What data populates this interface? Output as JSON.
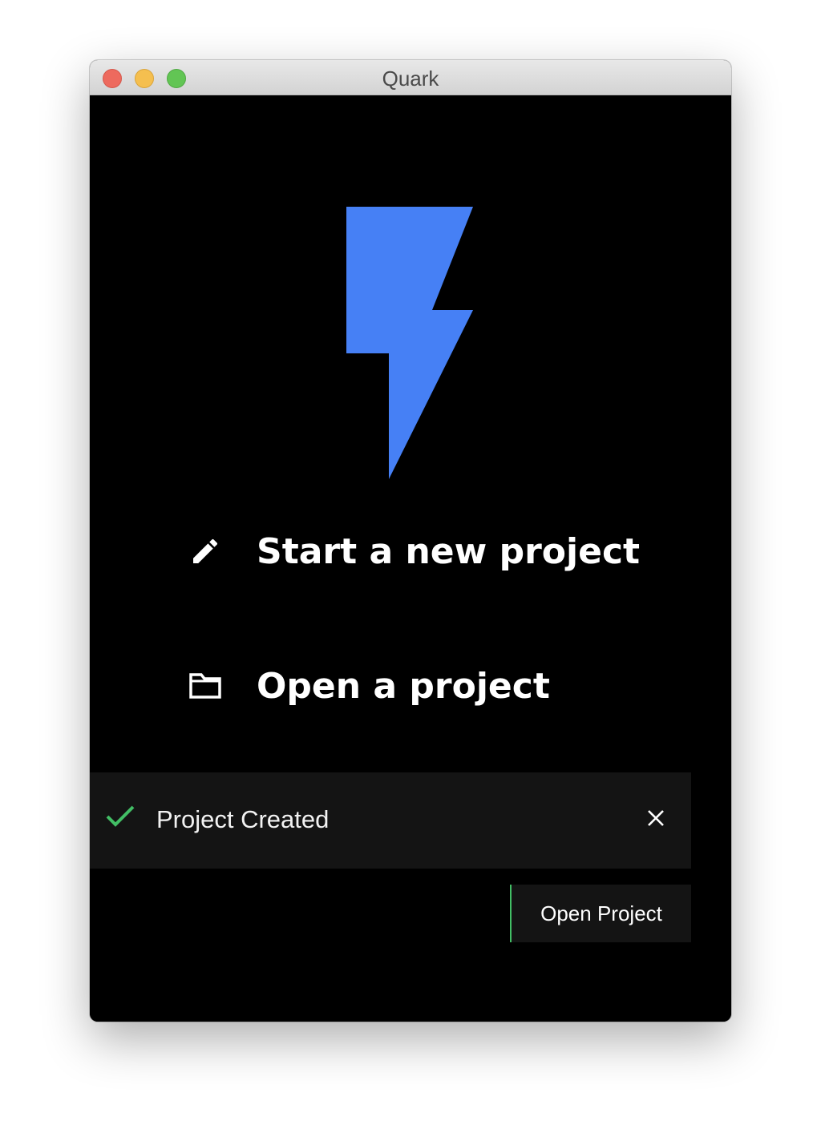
{
  "window": {
    "title": "Quark"
  },
  "colors": {
    "brand": "#4680f5",
    "background": "#000000",
    "toast_background": "#141414",
    "success": "#42be65",
    "text": "#ffffff"
  },
  "logo": {
    "icon": "lightning-bolt-logo"
  },
  "menu": {
    "new_project": {
      "icon": "pencil-icon",
      "label": "Start a new project"
    },
    "open_project": {
      "icon": "folder-icon",
      "label": "Open a project"
    }
  },
  "notification": {
    "icon": "checkmark-icon",
    "message": "Project Created",
    "dismiss_icon": "close-icon",
    "action_label": "Open Project"
  }
}
